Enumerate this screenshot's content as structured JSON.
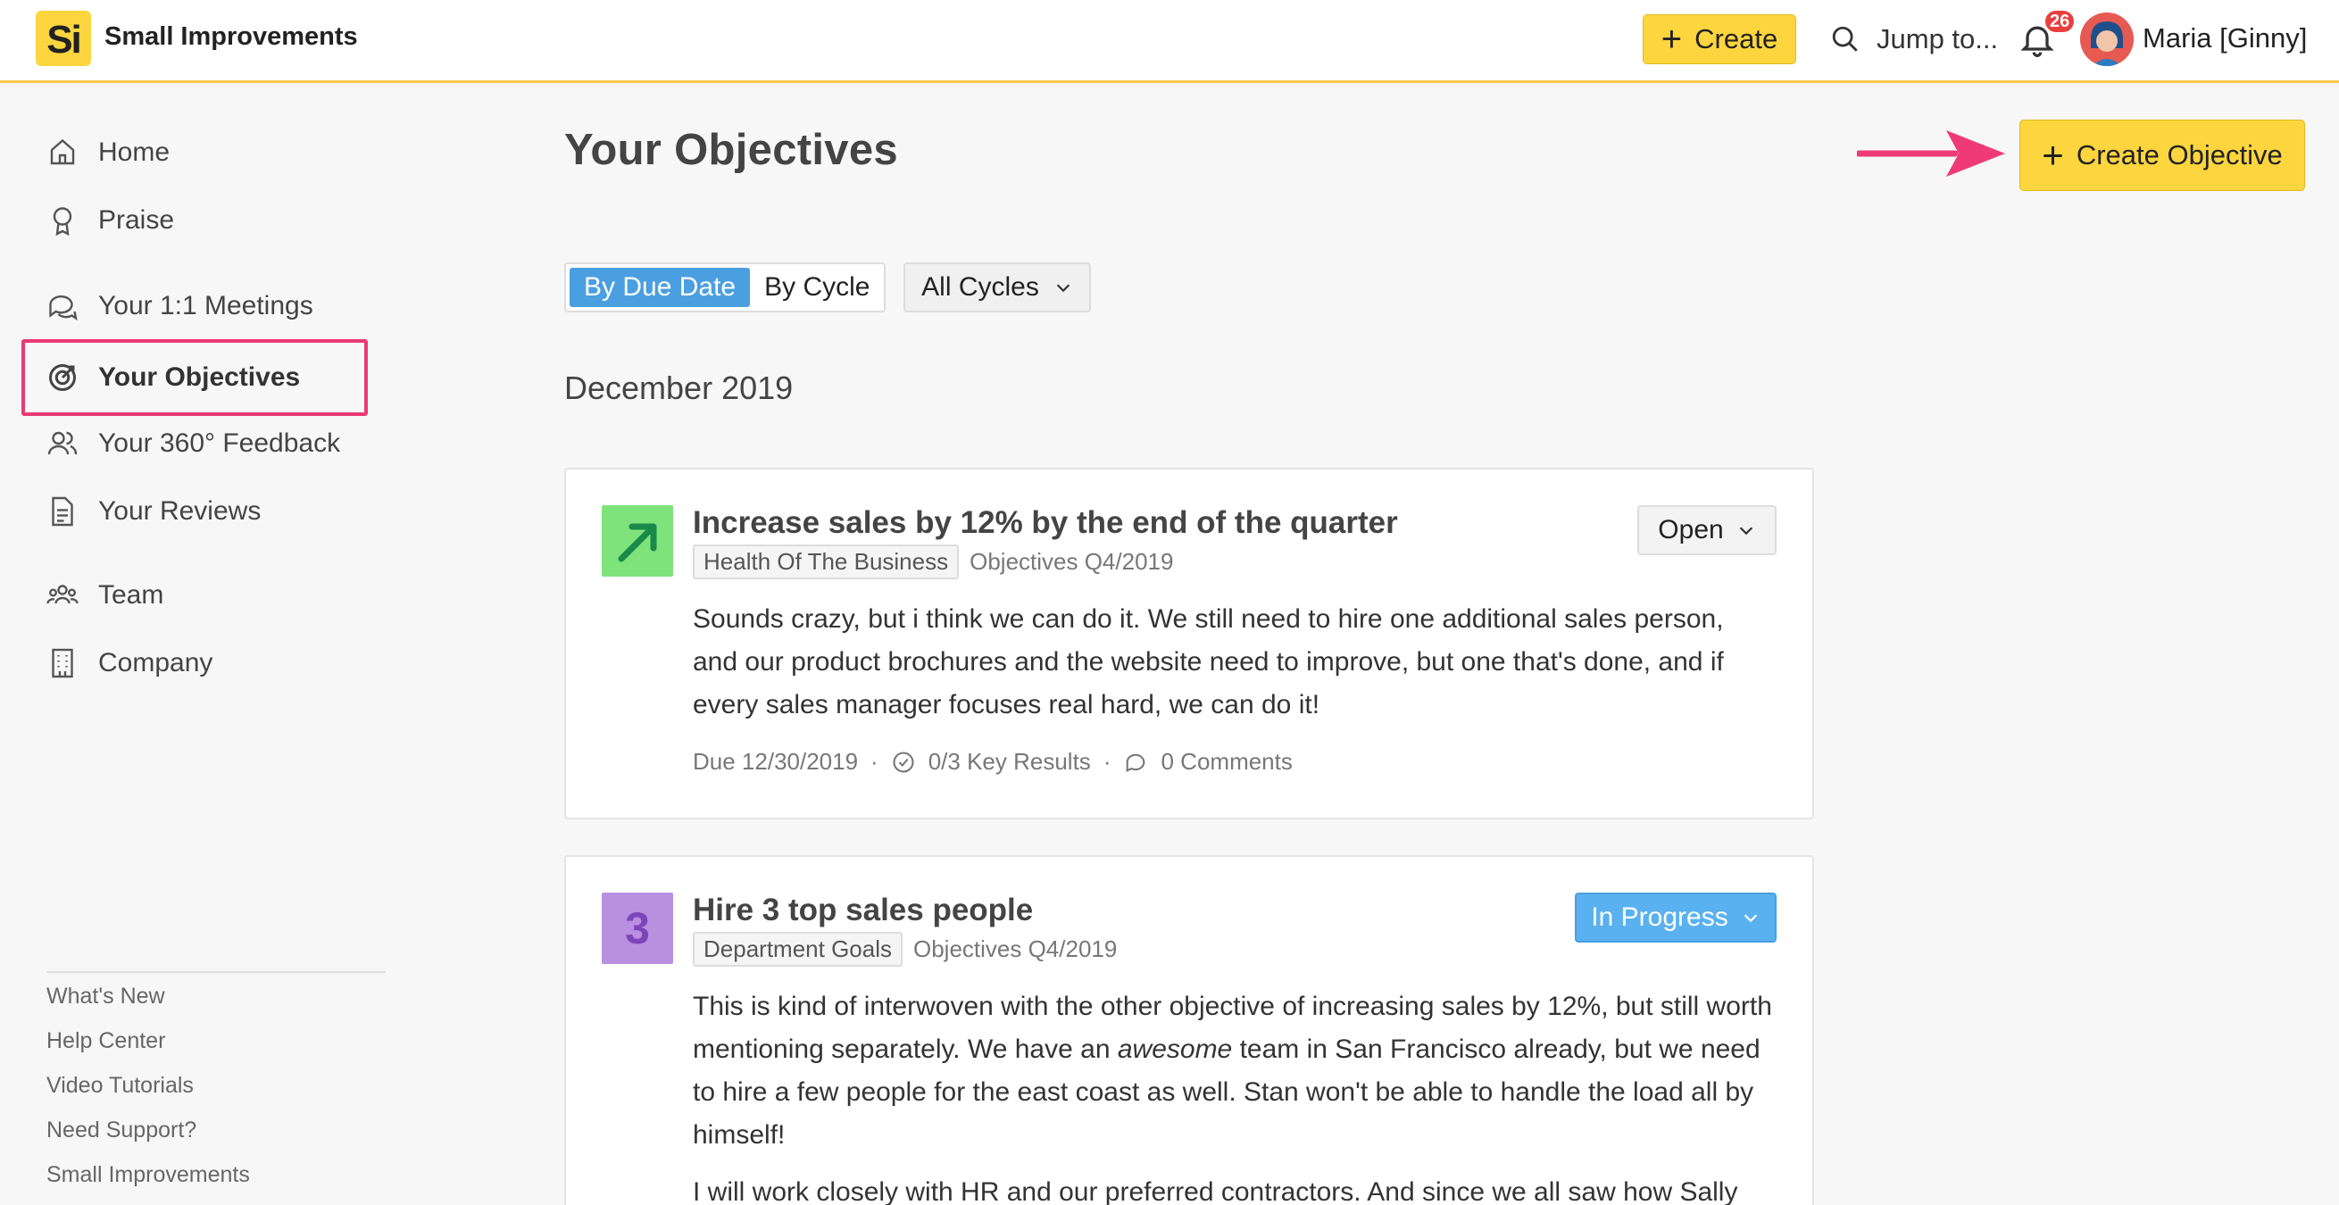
{
  "app": {
    "logo_text": "Si",
    "name": "Small Improvements"
  },
  "topbar": {
    "create_label": "Create",
    "jump_label": "Jump to...",
    "notification_count": "26",
    "user_name": "Maria [Ginny]"
  },
  "sidebar": {
    "items": [
      {
        "label": "Home",
        "icon": "home-icon"
      },
      {
        "label": "Praise",
        "icon": "ribbon-icon"
      },
      {
        "label": "Your 1:1 Meetings",
        "icon": "chat-icon"
      },
      {
        "label": "Your Objectives",
        "icon": "target-icon",
        "active": true
      },
      {
        "label": "Your 360° Feedback",
        "icon": "people-icon"
      },
      {
        "label": "Your Reviews",
        "icon": "document-icon"
      },
      {
        "label": "Team",
        "icon": "team-icon"
      },
      {
        "label": "Company",
        "icon": "building-icon"
      }
    ],
    "footer_links": [
      "What's New",
      "Help Center",
      "Video Tutorials",
      "Need Support?",
      "Small Improvements"
    ]
  },
  "main": {
    "title": "Your Objectives",
    "create_objective_label": "Create Objective",
    "view_toggle": {
      "by_due_date": "By Due Date",
      "by_cycle": "By Cycle",
      "selected": "By Due Date"
    },
    "cycle_filter": "All Cycles",
    "group_heading": "December 2019",
    "objectives": [
      {
        "title": "Increase sales by 12% by the end of the quarter",
        "tag": "Health Of The Business",
        "cycle": "Objectives Q4/2019",
        "status": "Open",
        "description": "Sounds crazy, but i think we can do it. We still need to hire one additional sales person, and our product brochures and the website need to improve, but one that's done, and if every sales manager focuses real hard, we can do it!",
        "due": "Due 12/30/2019",
        "key_results": "0/3 Key Results",
        "comments": "0 Comments",
        "icon_color": "#7ee37a"
      },
      {
        "title": "Hire 3 top sales people",
        "tag": "Department Goals",
        "cycle": "Objectives Q4/2019",
        "status": "In Progress",
        "icon_text": "3",
        "icon_color": "#b98fe0",
        "description_part1": "This is kind of interwoven with the other objective of increasing sales by 12%, but still worth mentioning separately. We have an ",
        "description_emphasis": "awesome",
        "description_part2": " team in San Francisco already, but we need to hire a few people for the east coast as well. Stan won't be able to handle the load all by himself!",
        "description_more": "I will work closely with HR and our preferred contractors. And since we all saw how Sally"
      }
    ]
  },
  "colors": {
    "accent_yellow": "#fcd53f",
    "highlight_pink": "#e93a74",
    "primary_blue": "#4a9fe0"
  }
}
